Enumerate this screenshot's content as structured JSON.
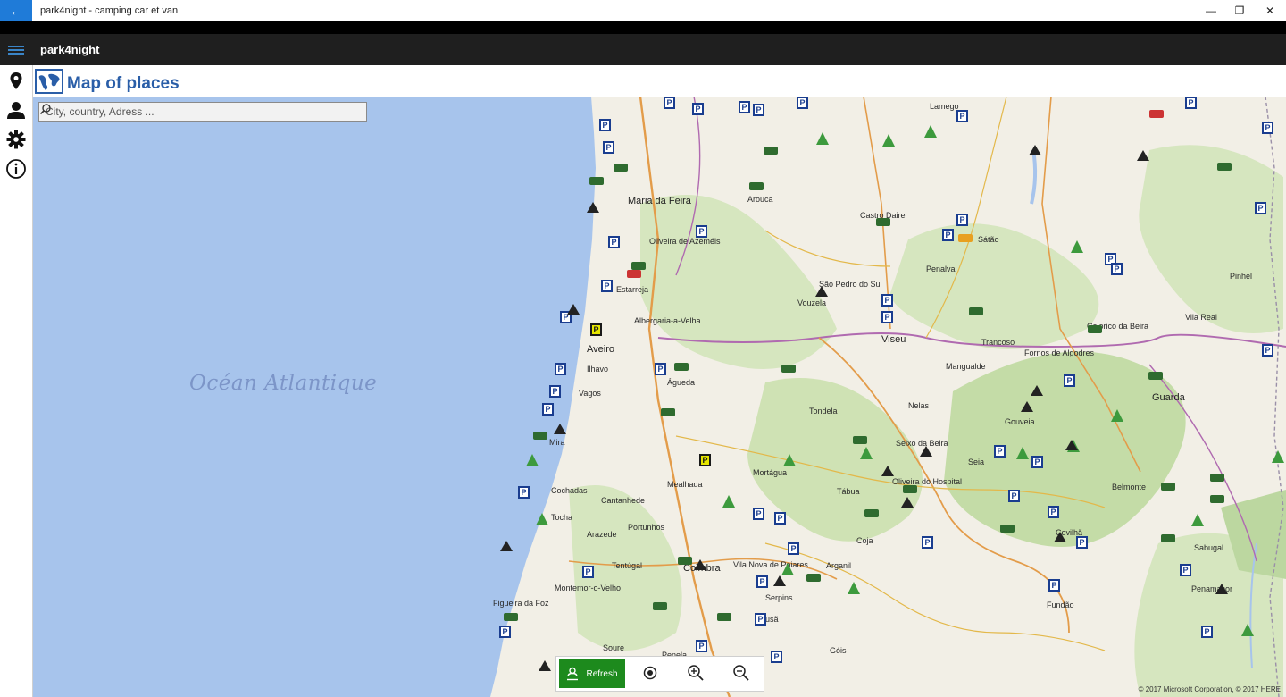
{
  "window": {
    "title": "park4night - camping car et van",
    "back_icon": "back-arrow-icon",
    "minimize": "—",
    "maximize": "❐",
    "close": "✕"
  },
  "appbar": {
    "name": "park4night"
  },
  "rail": {
    "items": [
      {
        "icon": "location-pin-icon"
      },
      {
        "icon": "user-icon"
      },
      {
        "icon": "gear-icon"
      },
      {
        "icon": "info-icon"
      }
    ]
  },
  "page": {
    "title": "Map of places"
  },
  "search": {
    "placeholder": "City, country, Adress ..."
  },
  "map": {
    "ocean_label": "Océan Atlantique",
    "places": [
      {
        "name": "Maria da Feira",
        "cls": "big"
      },
      {
        "name": "Oliveira de Azeméis",
        "cls": "med"
      },
      {
        "name": "Estarreja",
        "cls": "med"
      },
      {
        "name": "Albergaria-a-Velha",
        "cls": "med"
      },
      {
        "name": "Aveiro",
        "cls": "big"
      },
      {
        "name": "Ílhavo",
        "cls": "med"
      },
      {
        "name": "Vagos",
        "cls": "med"
      },
      {
        "name": "Águeda",
        "cls": "med"
      },
      {
        "name": "Viseu",
        "cls": "big"
      },
      {
        "name": "Mangualde",
        "cls": "med"
      },
      {
        "name": "Tondela",
        "cls": "med"
      },
      {
        "name": "Guarda",
        "cls": "big"
      },
      {
        "name": "Covilhã",
        "cls": "med"
      },
      {
        "name": "Coimbra",
        "cls": "big"
      },
      {
        "name": "Figueira da Foz",
        "cls": "med"
      },
      {
        "name": "Montemor-o-Velho",
        "cls": "med"
      },
      {
        "name": "Cantanhede",
        "cls": "med"
      },
      {
        "name": "Mealhada",
        "cls": "med"
      },
      {
        "name": "Lousã",
        "cls": "med"
      },
      {
        "name": "Fundão",
        "cls": "med"
      },
      {
        "name": "Seia",
        "cls": "med"
      },
      {
        "name": "Gouveia",
        "cls": "med"
      },
      {
        "name": "Arouca",
        "cls": "med"
      },
      {
        "name": "Castro Daire",
        "cls": "med"
      },
      {
        "name": "Sátão",
        "cls": "med"
      },
      {
        "name": "Lamego",
        "cls": "med"
      },
      {
        "name": "Trancoso",
        "cls": "med"
      },
      {
        "name": "Celorico da Beira",
        "cls": "med"
      },
      {
        "name": "Belmonte",
        "cls": "med"
      },
      {
        "name": "Oliveira do Hospital",
        "cls": "med"
      },
      {
        "name": "Penela",
        "cls": "med"
      },
      {
        "name": "Góis",
        "cls": "med"
      },
      {
        "name": "Tábua",
        "cls": "med"
      },
      {
        "name": "Mortágua",
        "cls": "med"
      },
      {
        "name": "Vouzela",
        "cls": "med"
      },
      {
        "name": "São Pedro do Sul",
        "cls": "med"
      },
      {
        "name": "Sabugal",
        "cls": "med"
      },
      {
        "name": "Penamacor",
        "cls": "med"
      },
      {
        "name": "Pinhel",
        "cls": "med"
      },
      {
        "name": "Vila Nova de Poiares",
        "cls": "med"
      },
      {
        "name": "Soure",
        "cls": "med"
      },
      {
        "name": "Mira",
        "cls": "med"
      },
      {
        "name": "Tocha",
        "cls": "med"
      },
      {
        "name": "Cochadas",
        "cls": "med"
      },
      {
        "name": "Arazede",
        "cls": "med"
      },
      {
        "name": "Tentúgal",
        "cls": "med"
      },
      {
        "name": "Portunhos",
        "cls": "med"
      },
      {
        "name": "Serpins",
        "cls": "med"
      },
      {
        "name": "Arganil",
        "cls": "med"
      },
      {
        "name": "Coja",
        "cls": "med"
      },
      {
        "name": "Seixo da Beira",
        "cls": "med"
      },
      {
        "name": "Nelas",
        "cls": "med"
      },
      {
        "name": "Fornos de Algodres",
        "cls": "med"
      },
      {
        "name": "Penalva",
        "cls": "med"
      },
      {
        "name": "Vila Real",
        "cls": "med"
      }
    ],
    "copyright": "© 2017 Microsoft Corporation, © 2017 HERE"
  },
  "toolbar": {
    "refresh_label": "Refresh",
    "refresh_icon": "person-pin-icon",
    "locate_icon": "locate-icon",
    "zoom_in_icon": "zoom-in-icon",
    "zoom_out_icon": "zoom-out-icon"
  },
  "colors": {
    "accent": "#1f7bd8",
    "title_blue": "#2a5ea8",
    "refresh_green": "#1d8a1d",
    "ocean": "#a7c4ec",
    "land": "#f2efe6",
    "forest": "#c9dfb0"
  }
}
